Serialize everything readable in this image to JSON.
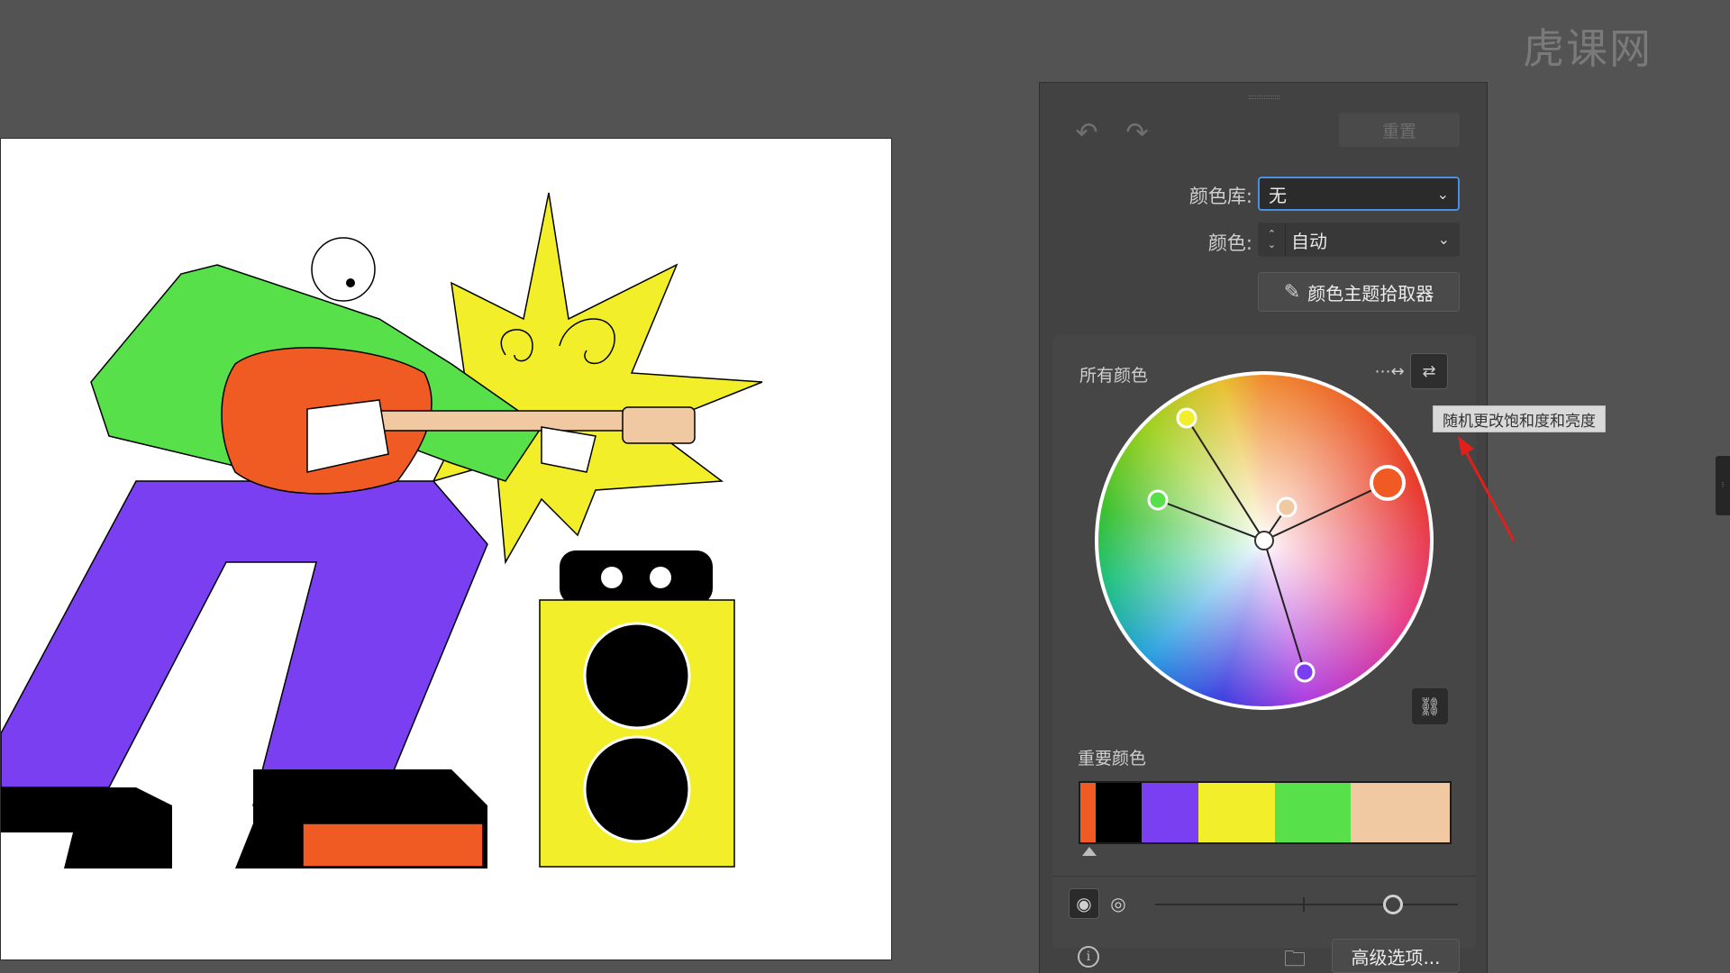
{
  "watermark": "虎课网",
  "panel": {
    "undo_icon": "undo-icon",
    "redo_icon": "redo-icon",
    "reset_label": "重置",
    "color_library_label": "颜色库:",
    "color_library_value": "无",
    "colors_label": "颜色:",
    "colors_value": "自动",
    "theme_picker_label": "颜色主题拾取器",
    "all_colors_label": "所有颜色",
    "important_colors_label": "重要颜色",
    "advanced_options_label": "高级选项...",
    "tooltip": "随机更改饱和度和亮度"
  },
  "important_colors": [
    {
      "color": "#f05a23",
      "weight": 4
    },
    {
      "color": "#000000",
      "weight": 12
    },
    {
      "color": "#7b3ff2",
      "weight": 15
    },
    {
      "color": "#f2ee2a",
      "weight": 20
    },
    {
      "color": "#58e04a",
      "weight": 20
    },
    {
      "color": "#f0c9a2",
      "weight": 26
    }
  ],
  "colors": {
    "accent": "#4a90e2",
    "panel_bg": "#424242",
    "annotation_arrow": "#e0201a"
  }
}
